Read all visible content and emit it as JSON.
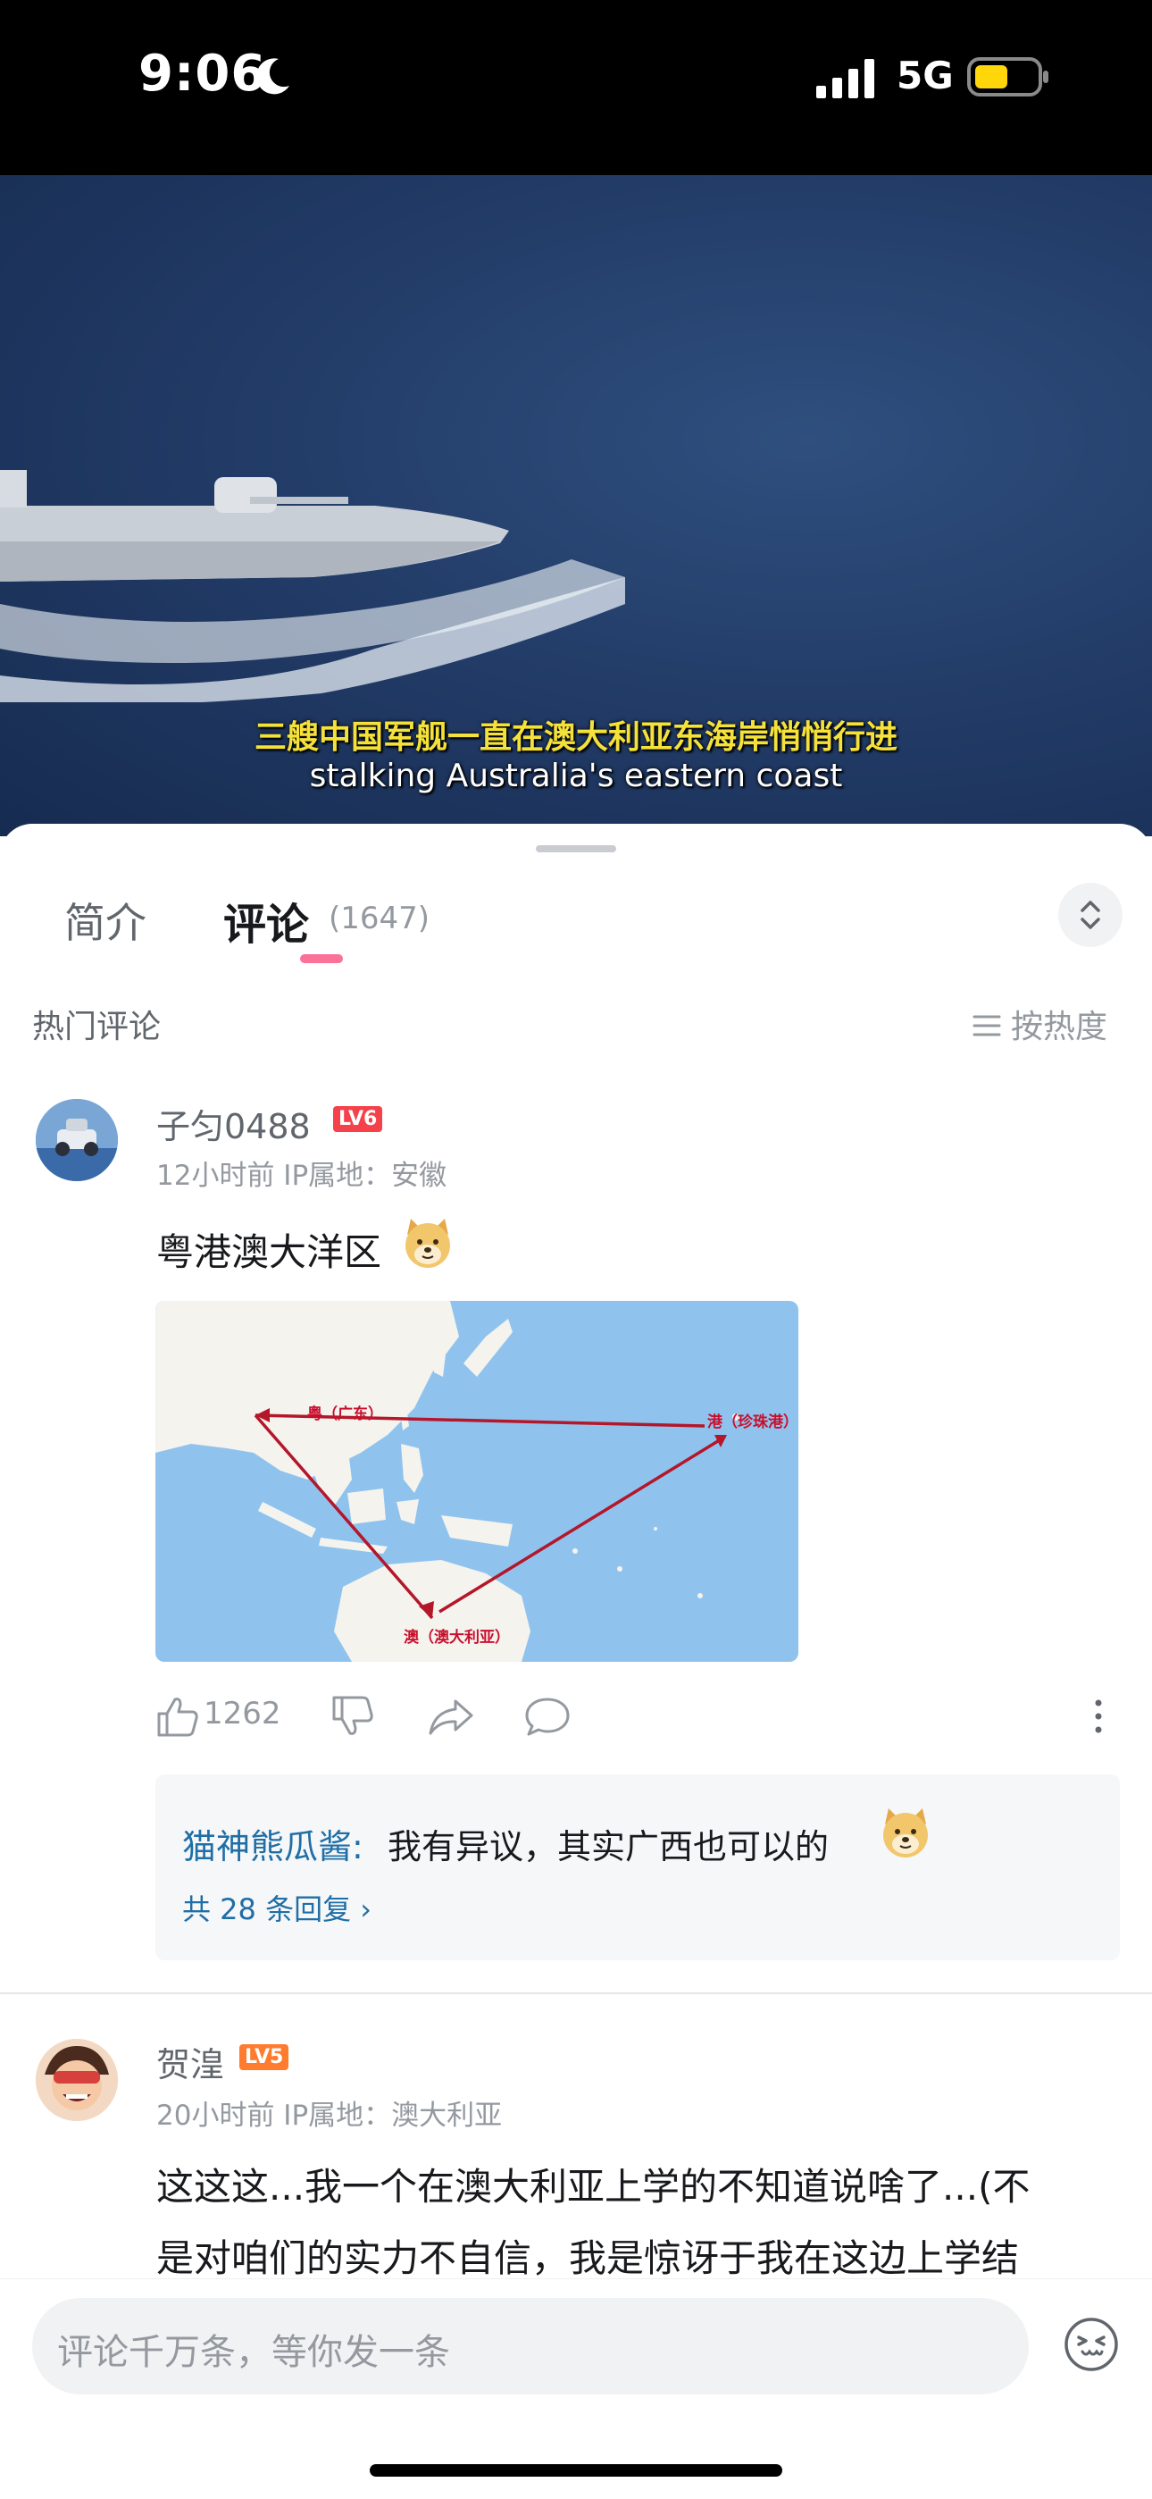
{
  "status_bar": {
    "time": "9:06",
    "network": "5G"
  },
  "video": {
    "subtitle_cn": "三艘中国军舰一直在澳大利亚东海岸悄悄行进",
    "subtitle_en": "stalking Australia's eastern coast"
  },
  "tabs": [
    {
      "label": "简介"
    },
    {
      "label": "评论",
      "count": "(1647)"
    }
  ],
  "section": {
    "title": "热门评论",
    "sort_label": "按热度"
  },
  "comments": [
    {
      "user": "子匀0488",
      "level": "LV6",
      "meta": "12小时前  IP属地：安徽",
      "text": "粤港澳大洋区",
      "likes": "1262",
      "map_labels": {
        "guangdong": "粤（广东）",
        "pearl": "港（珍珠港）",
        "australia": "澳（澳大利亚）"
      },
      "reply": {
        "author": "猫神熊瓜酱:",
        "text": "我有异议，其实广西也可以的",
        "more": "共 28 条回复 ›"
      }
    },
    {
      "user": "贺湟",
      "level": "LV5",
      "meta": "20小时前  IP属地：澳大利亚",
      "text_line1": "这这这...我一个在澳大利亚上学的不知道说啥了...(不",
      "text_line2": "是对咱们的实力不自信，我是惊讶于我在这边上学结"
    }
  ],
  "input": {
    "placeholder": "评论千万条，等你发一条"
  },
  "colors": {
    "accent_pink": "#fb7299",
    "link_blue": "#1f6ea6",
    "lv6_red": "#f5424a",
    "lv5_orange": "#ff7b2e"
  }
}
